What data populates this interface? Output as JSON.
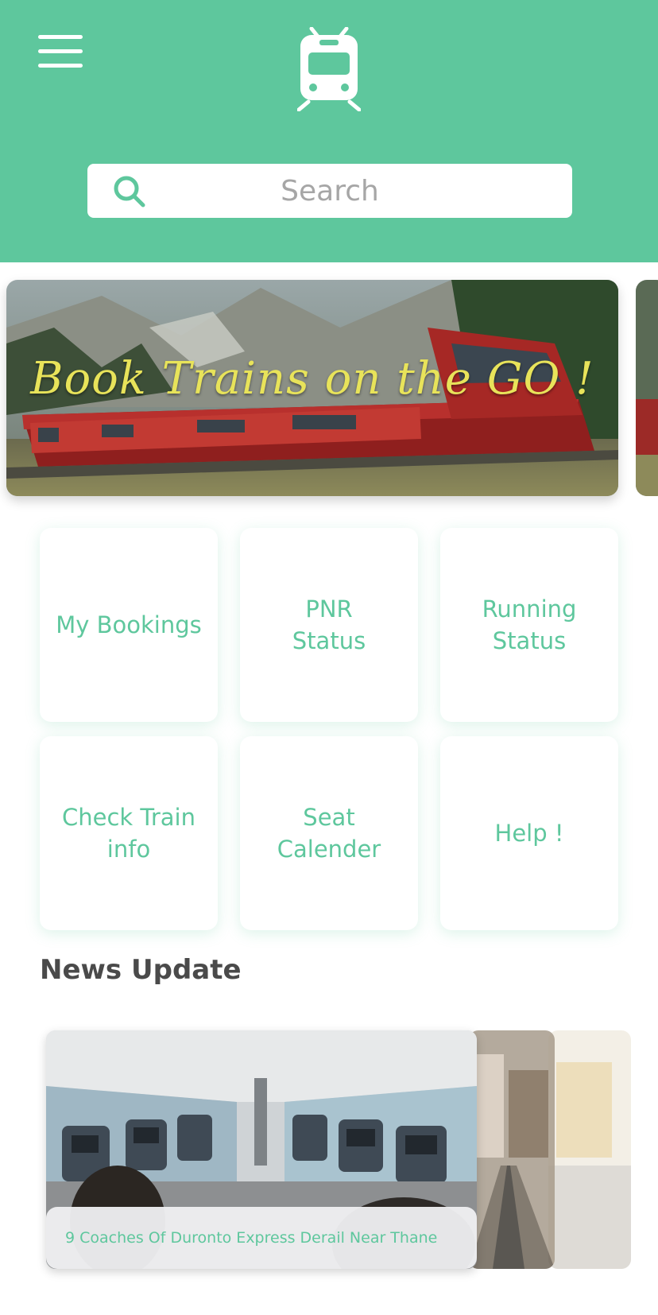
{
  "colors": {
    "accent": "#5ec79d",
    "banner_title": "#e8e35a",
    "heading": "#4a4a4a"
  },
  "header": {
    "menu_icon": "hamburger-menu-icon",
    "logo_icon": "train-icon",
    "search": {
      "icon": "search-icon",
      "placeholder": "Search",
      "value": ""
    }
  },
  "banner": {
    "title": "Book Trains on the GO !"
  },
  "tiles": [
    {
      "label": "My Bookings"
    },
    {
      "label": "PNR\nStatus"
    },
    {
      "label": "Running\nStatus"
    },
    {
      "label": "Check Train\ninfo"
    },
    {
      "label": "Seat\nCalender"
    },
    {
      "label": "Help !"
    }
  ],
  "news": {
    "heading": "News Update",
    "cards": [
      {
        "title": "9 Coaches Of Duronto Express Derail Near Thane"
      }
    ]
  }
}
